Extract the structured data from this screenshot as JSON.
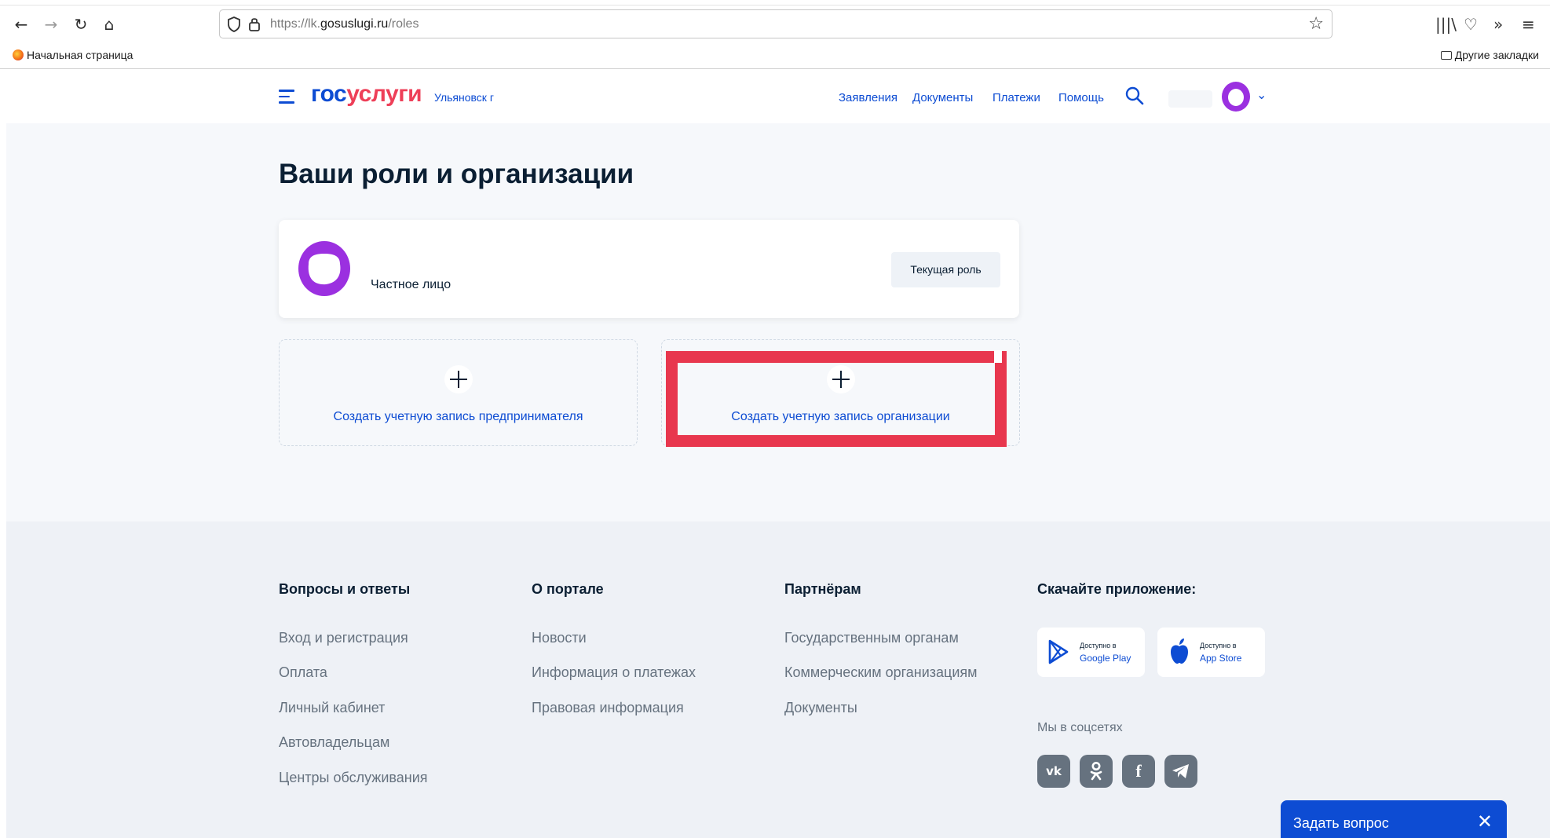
{
  "browser": {
    "url_prefix": "https://lk.",
    "url_domain": "gosuslugi.ru",
    "url_path": "/roles",
    "bookmark_home": "Начальная страница",
    "bookmark_other": "Другие закладки"
  },
  "header": {
    "logo_part1": "гос",
    "logo_part2": "услуги",
    "region": "Ульяновск г",
    "nav": [
      "Заявления",
      "Документы",
      "Платежи",
      "Помощь"
    ]
  },
  "main": {
    "title": "Ваши роли и организации",
    "role": {
      "name": "Частное лицо",
      "button": "Текущая роль"
    },
    "add_entrepreneur": "Создать учетную запись предпринимателя",
    "add_organization": "Создать учетную запись организации"
  },
  "footer": {
    "col1": {
      "title": "Вопросы и ответы",
      "links": [
        "Вход и регистрация",
        "Оплата",
        "Личный кабинет",
        "Автовладельцам",
        "Центры обслуживания"
      ]
    },
    "col2": {
      "title": "О портале",
      "links": [
        "Новости",
        "Информация о платежах",
        "Правовая информация"
      ]
    },
    "col3": {
      "title": "Партнёрам",
      "links": [
        "Государственным органам",
        "Коммерческим организациям",
        "Документы"
      ]
    },
    "col4": {
      "title": "Скачайте приложение:",
      "google_small": "Доступно в",
      "google_big": "Google Play",
      "apple_small": "Доступно в",
      "apple_big": "App Store",
      "social_label": "Мы в соцсетях",
      "social": [
        "vk-icon",
        "ok-icon",
        "facebook-icon",
        "telegram-icon"
      ]
    }
  },
  "ask_widget": {
    "label": "Задать вопрос"
  },
  "colors": {
    "brand_blue": "#0d4cd3",
    "brand_red": "#ee3f58",
    "highlight": "#e8374e",
    "avatar": "#9b30e0"
  }
}
